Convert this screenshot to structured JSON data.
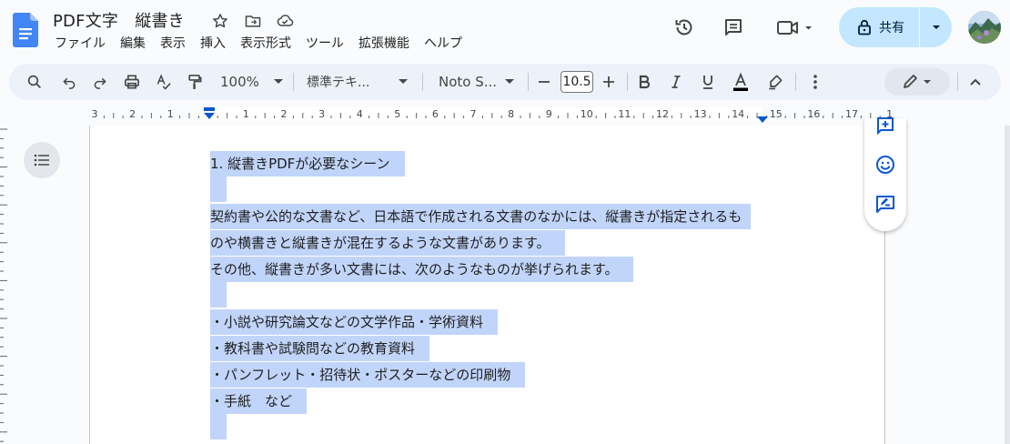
{
  "header": {
    "title": "PDF文字　縦書き",
    "menu": [
      "ファイル",
      "編集",
      "表示",
      "挿入",
      "表示形式",
      "ツール",
      "拡張機能",
      "ヘルプ"
    ],
    "share_label": "共有"
  },
  "toolbar": {
    "zoom": "100%",
    "style": "標準テキ...",
    "font": "Noto S...",
    "font_size": "10.5"
  },
  "ruler": {
    "labels": [
      "3",
      "2",
      "1",
      "",
      "1",
      "2",
      "3",
      "4",
      "5",
      "6",
      "7",
      "8",
      "9",
      "10",
      "11",
      "12",
      "13",
      "14",
      "15",
      "16",
      "17",
      "1"
    ]
  },
  "document": {
    "lines": [
      "1. 縦書きPDFが必要なシーン",
      "",
      "契約書や公的な文書など、日本語で作成される文書のなかには、縦書きが指定されるも",
      "のや横書きと縦書きが混在するような文書があります。",
      "その他、縦書きが多い文書には、次のようなものが挙げられます。",
      "",
      "・小説や研究論文などの文学作品・学術資料",
      "・教科書や試験問などの教育資料",
      "・パンフレット・招待状・ポスターなどの印刷物",
      "・手紙　など",
      ""
    ]
  },
  "colors": {
    "accent": "#0b57d0",
    "selection": "#c1d5fa",
    "share_bg": "#c2e7ff",
    "toolbar_bg": "#edf2fa"
  },
  "icons": {
    "header": [
      "docs-logo",
      "star-icon",
      "move-folder-icon",
      "cloud-saved-icon",
      "history-icon",
      "comment-icon",
      "meet-icon",
      "lock-icon",
      "caret-down-icon"
    ],
    "toolbar": [
      "search-icon",
      "undo-icon",
      "redo-icon",
      "print-icon",
      "spellcheck-icon",
      "paint-format-icon",
      "minus-icon",
      "plus-icon",
      "bold-icon",
      "italic-icon",
      "underline-icon",
      "text-color-icon",
      "highlight-icon",
      "more-icon",
      "edit-mode-icon",
      "collapse-icon"
    ],
    "side": [
      "add-comment-icon",
      "emoji-icon",
      "suggest-edit-icon"
    ]
  }
}
